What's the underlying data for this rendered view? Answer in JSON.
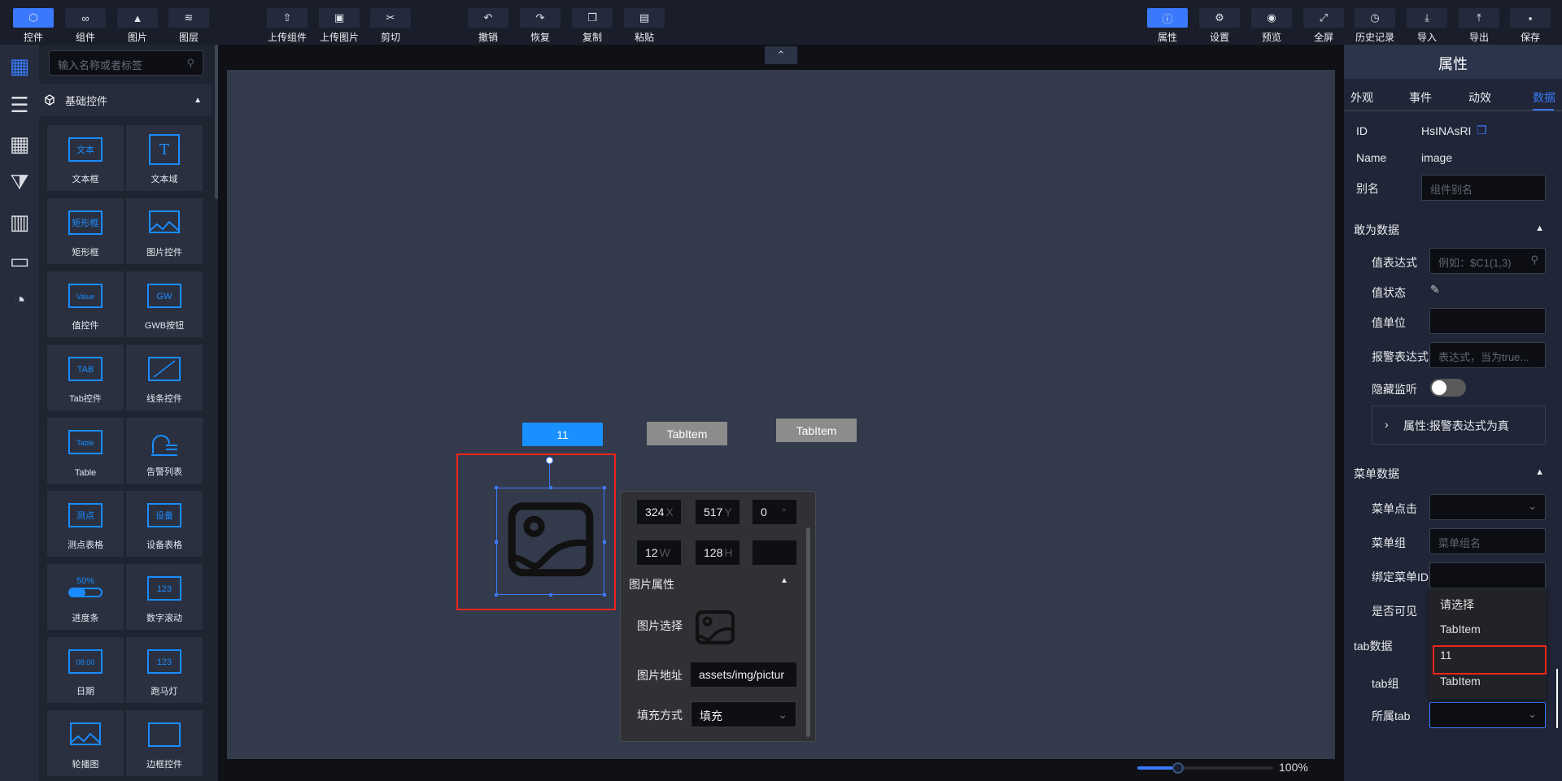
{
  "toolbar": {
    "left": [
      {
        "label": "控件",
        "icon": "cube-icon",
        "active": true
      },
      {
        "label": "组件",
        "icon": "link-icon"
      },
      {
        "label": "图片",
        "icon": "image-icon"
      },
      {
        "label": "图层",
        "icon": "layers-icon"
      }
    ],
    "middle": [
      {
        "label": "上传组件",
        "icon": "upload-component-icon"
      },
      {
        "label": "上传图片",
        "icon": "upload-image-icon"
      },
      {
        "label": "剪切",
        "icon": "cut-icon"
      }
    ],
    "edit": [
      {
        "label": "撤销",
        "icon": "undo-icon"
      },
      {
        "label": "恢复",
        "icon": "redo-icon"
      },
      {
        "label": "复制",
        "icon": "copy-icon"
      },
      {
        "label": "粘贴",
        "icon": "paste-icon"
      }
    ],
    "right": [
      {
        "label": "属性",
        "icon": "info-icon",
        "active": true
      },
      {
        "label": "设置",
        "icon": "gear-icon"
      },
      {
        "label": "预览",
        "icon": "preview-icon"
      },
      {
        "label": "全屏",
        "icon": "fullscreen-icon"
      },
      {
        "label": "历史记录",
        "icon": "history-icon"
      },
      {
        "label": "导入",
        "icon": "import-icon"
      },
      {
        "label": "导出",
        "icon": "export-icon"
      },
      {
        "label": "保存",
        "icon": "save-icon"
      }
    ]
  },
  "sidebar": {
    "icons": [
      "grid-icon",
      "sliders-icon",
      "table-icon",
      "filter-list-icon",
      "bar-chart-icon",
      "video-icon",
      "pie-chart-icon"
    ],
    "search_placeholder": "输入名称或者标签",
    "category": "基础控件",
    "widgets": [
      {
        "label": "文本框",
        "icon": "textbox-icon",
        "glyph": "文本"
      },
      {
        "label": "文本域",
        "icon": "textarea-icon",
        "glyph": "T"
      },
      {
        "label": "矩形框",
        "icon": "rectangle-icon",
        "glyph": "矩形框"
      },
      {
        "label": "图片控件",
        "icon": "image-widget-icon",
        "glyph": ""
      },
      {
        "label": "值控件",
        "icon": "value-icon",
        "glyph": "Value"
      },
      {
        "label": "GWB按钮",
        "icon": "gwb-button-icon",
        "glyph": "GW"
      },
      {
        "label": "Tab控件",
        "icon": "tab-icon",
        "glyph": "TAB"
      },
      {
        "label": "线条控件",
        "icon": "line-icon",
        "glyph": ""
      },
      {
        "label": "Table",
        "icon": "table-widget-icon",
        "glyph": "Table"
      },
      {
        "label": "告警列表",
        "icon": "alarm-list-icon",
        "glyph": ""
      },
      {
        "label": "测点表格",
        "icon": "point-table-icon",
        "glyph": "测点"
      },
      {
        "label": "设备表格",
        "icon": "device-table-icon",
        "glyph": "设备"
      },
      {
        "label": "进度条",
        "icon": "progress-icon",
        "glyph": "50%"
      },
      {
        "label": "数字滚动",
        "icon": "number-scroll-icon",
        "glyph": "123"
      },
      {
        "label": "日期",
        "icon": "date-icon",
        "glyph": "08:00"
      },
      {
        "label": "跑马灯",
        "icon": "marquee-icon",
        "glyph": "123"
      },
      {
        "label": "轮播图",
        "icon": "carousel-icon",
        "glyph": ""
      },
      {
        "label": "边框控件",
        "icon": "border-icon",
        "glyph": ""
      }
    ]
  },
  "canvas": {
    "tabs": [
      {
        "label": "11",
        "color": "#1890ff"
      },
      {
        "label": "TabItem",
        "color": "#8c8c8c"
      },
      {
        "label": "TabItem",
        "color": "#8c8c8c"
      }
    ],
    "popup": {
      "x": "324",
      "x_unit": "X",
      "y": "517",
      "y_unit": "Y",
      "rot": "0",
      "rot_unit": "°",
      "w": "12",
      "w_unit": "W",
      "h": "128",
      "h_unit": "H",
      "section": "图片属性",
      "img_select": "图片选择",
      "img_url_label": "图片地址",
      "img_url": "assets/img/pictur",
      "fill_label": "填充方式",
      "fill_value": "填充"
    },
    "zoom": "100%",
    "zoom_fraction": 0.3
  },
  "props": {
    "title": "属性",
    "tabs": [
      "外观",
      "事件",
      "动效",
      "数据"
    ],
    "active_tab": 3,
    "id_label": "ID",
    "id_value": "HsINAsRI",
    "name_label": "Name",
    "name_value": "image",
    "alias_label": "别名",
    "alias_placeholder": "组件别名",
    "data_section": "敢为数据",
    "expr_label": "值表达式",
    "expr_placeholder": "例如：$C1(1,3)",
    "state_label": "值状态",
    "unit_label": "值单位",
    "alarm_label": "报警表达式",
    "alarm_placeholder": "表达式，当为true...",
    "hide_label": "隐藏监听",
    "alarm_prop": "属性:报警表达式为真",
    "menu_section": "菜单数据",
    "menu_click": "菜单点击",
    "menu_group": "菜单组",
    "menu_group_placeholder": "菜单组名",
    "bind_menu": "绑定菜单ID",
    "visible": "是否可见",
    "tab_section": "tab数据",
    "tab_group": "tab组",
    "owner_tab": "所属tab",
    "dropdown": [
      "请选择",
      "TabItem",
      "11",
      "TabItem"
    ]
  }
}
